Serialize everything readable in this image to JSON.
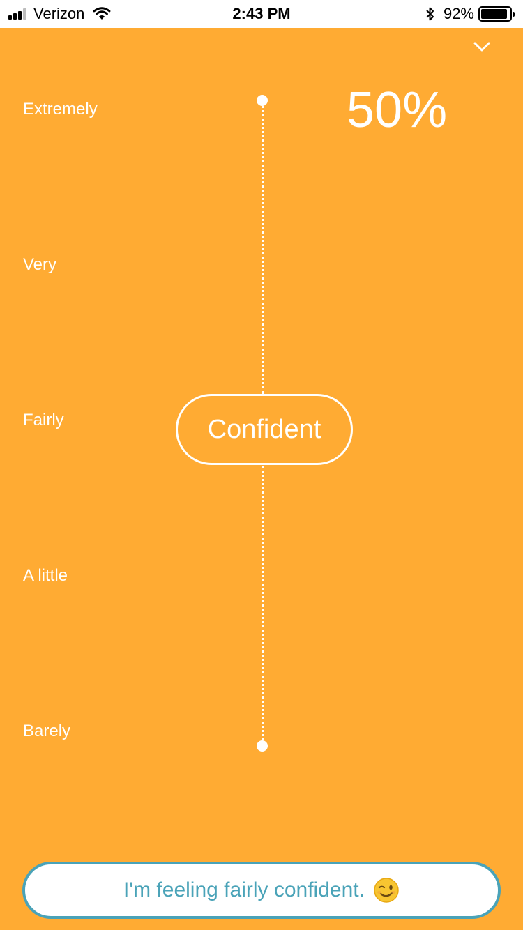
{
  "status_bar": {
    "carrier": "Verizon",
    "time": "2:43 PM",
    "battery_percent": "92%",
    "battery_level": 0.92,
    "signal_bars": 3,
    "icons": [
      "signal-icon",
      "wifi-icon",
      "bluetooth-icon",
      "battery-icon"
    ]
  },
  "header": {
    "collapse_icon": "chevron-down-icon"
  },
  "scale": {
    "labels": [
      "Extremely",
      "Very",
      "Fairly",
      "A little",
      "Barely"
    ]
  },
  "readout": {
    "percent": "50%",
    "value": 0.5
  },
  "slider": {
    "thumb_label": "Confident"
  },
  "submit": {
    "text": "I'm feeling fairly confident.",
    "emoji_icon": "winking-face-icon"
  },
  "colors": {
    "background": "#ffab33",
    "accent": "#4aa3b8",
    "foreground": "#ffffff"
  }
}
